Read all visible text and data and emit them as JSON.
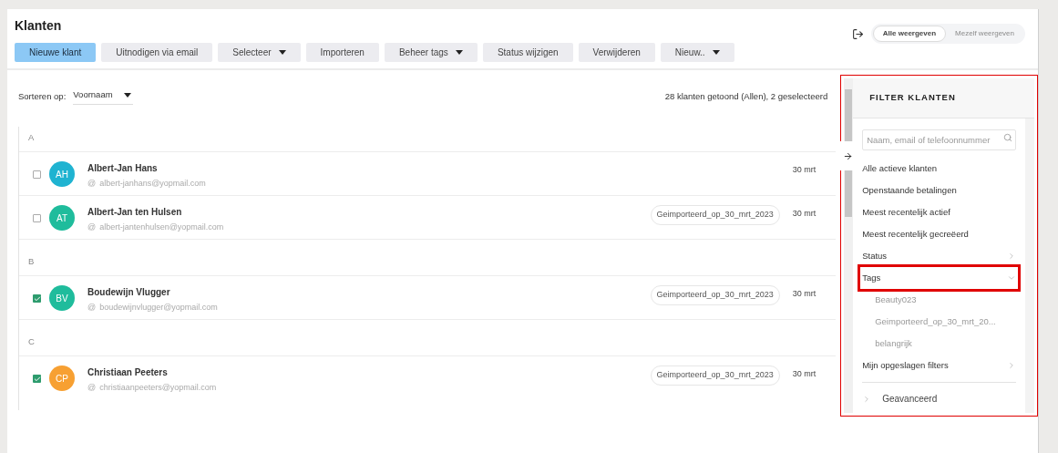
{
  "title": "Klanten",
  "toolbar": [
    {
      "label": "Nieuwe klant",
      "kind": "primary",
      "dropdown": false
    },
    {
      "label": "Uitnodigen via email",
      "kind": "default",
      "dropdown": false
    },
    {
      "label": "Selecteer",
      "kind": "default",
      "dropdown": true
    },
    {
      "label": "Importeren",
      "kind": "default",
      "dropdown": false
    },
    {
      "label": "Beheer tags",
      "kind": "default",
      "dropdown": true
    },
    {
      "label": "Status wijzigen",
      "kind": "default",
      "dropdown": false
    },
    {
      "label": "Verwijderen",
      "kind": "default",
      "dropdown": false
    },
    {
      "label": "Nieuw..",
      "kind": "default",
      "dropdown": true
    }
  ],
  "view_toggle": [
    {
      "label": "Alle weergeven",
      "selected": true
    },
    {
      "label": "Mezelf weergeven",
      "selected": false
    }
  ],
  "sort": {
    "label": "Sorteren op:",
    "value": "Voornaam"
  },
  "summary": "28 klanten getoond (Allen), 2 geselecteerd",
  "groups": [
    {
      "letter": "A",
      "customers": [
        {
          "initials": "AH",
          "color": "#1fb3d1",
          "name": "Albert-Jan Hans",
          "at_sign": "@",
          "email": "albert-janhans@yopmail.com",
          "checked": false,
          "date": "30 mrt"
        },
        {
          "initials": "AT",
          "color": "#1fbc9c",
          "name": "Albert-Jan ten Hulsen",
          "at_sign": "@",
          "email": "albert-jantenhulsen@yopmail.com",
          "checked": false,
          "tag": "Geimporteerd_op_30_mrt_2023",
          "date": "30 mrt"
        }
      ]
    },
    {
      "letter": "B",
      "customers": [
        {
          "initials": "BV",
          "color": "#1fbc9c",
          "name": "Boudewijn Vlugger",
          "at_sign": "@",
          "email": "boudewijnvlugger@yopmail.com",
          "checked": true,
          "tag": "Geimporteerd_op_30_mrt_2023",
          "date": "30 mrt"
        }
      ]
    },
    {
      "letter": "C",
      "customers": [
        {
          "initials": "CP",
          "color": "#f7a032",
          "name": "Christiaan Peeters",
          "at_sign": "@",
          "email": "christiaanpeeters@yopmail.com",
          "checked": true,
          "tag": "Geimporteerd_op_30_mrt_2023",
          "date": "30 mrt"
        }
      ]
    }
  ],
  "filter_panel": {
    "title": "FILTER KLANTEN",
    "highlighted": true,
    "search": {
      "placeholder": "Naam, email of telefoonnummer"
    },
    "items": [
      {
        "kind": "link",
        "label": "Alle actieve klanten"
      },
      {
        "kind": "link",
        "label": "Openstaande betalingen"
      },
      {
        "kind": "link",
        "label": "Meest recentelijk actief"
      },
      {
        "kind": "link",
        "label": "Meest recentelijk gecreëerd"
      },
      {
        "kind": "group",
        "label": "Status",
        "expanded": false,
        "highlighted": false
      },
      {
        "kind": "group",
        "label": "Tags",
        "expanded": true,
        "highlighted": true,
        "children": [
          {
            "label": "Beauty023"
          },
          {
            "label": "Geimporteerd_op_30_mrt_20..."
          },
          {
            "label": "belangrijk"
          }
        ]
      },
      {
        "kind": "group",
        "label": "Mijn opgeslagen filters",
        "expanded": false,
        "highlighted": false
      },
      {
        "kind": "advanced",
        "label": "Geavanceerd"
      }
    ]
  }
}
